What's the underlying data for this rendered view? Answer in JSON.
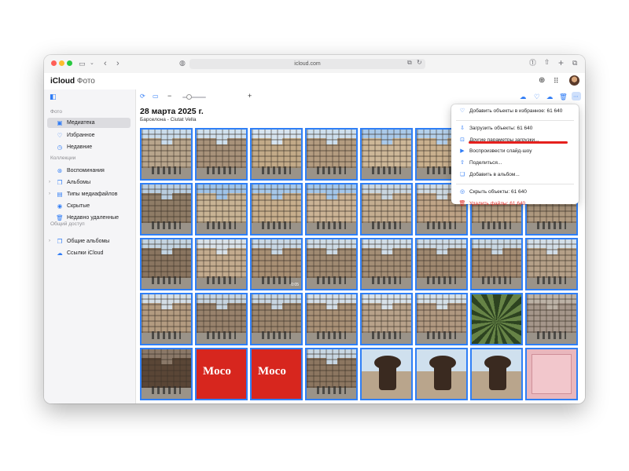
{
  "browser": {
    "url": "icloud.com",
    "traffic_lights": [
      "#ff5f57",
      "#febc2e",
      "#28c840"
    ]
  },
  "app": {
    "brand_bold": "iCloud",
    "brand_light": "Фото"
  },
  "sidebar": {
    "sections": [
      {
        "title": "Фото",
        "items": [
          {
            "label": "Медиатека",
            "icon": "photo-library-icon",
            "glyph": "▣",
            "active": true
          },
          {
            "label": "Избранное",
            "icon": "heart-icon",
            "glyph": "♡"
          },
          {
            "label": "Недавние",
            "icon": "clock-icon",
            "glyph": "◷"
          }
        ]
      },
      {
        "title": "Коллекции",
        "items": [
          {
            "label": "Воспоминания",
            "icon": "memories-icon",
            "glyph": "⊛"
          },
          {
            "label": "Альбомы",
            "icon": "albums-icon",
            "glyph": "❐",
            "chevron": true
          },
          {
            "label": "Типы медиафайлов",
            "icon": "media-types-icon",
            "glyph": "▤",
            "chevron": true
          },
          {
            "label": "Скрытые",
            "icon": "eye-hidden-icon",
            "glyph": "◉"
          },
          {
            "label": "Недавно удаленные",
            "icon": "trash-icon",
            "glyph": "🗑"
          }
        ]
      },
      {
        "title": "Общий доступ",
        "items": [
          {
            "label": "Общие альбомы",
            "icon": "shared-albums-icon",
            "glyph": "❐",
            "chevron": true
          },
          {
            "label": "Ссылки iCloud",
            "icon": "icloud-link-icon",
            "glyph": "☁"
          }
        ]
      }
    ]
  },
  "content": {
    "date_title": "28 марта 2025 г.",
    "location": "Барселона - Ciutat Vella",
    "zoom_minus": "−",
    "zoom_plus": "+",
    "zoom_level": 0.2
  },
  "thumbnails": [
    {
      "kind": "street",
      "sky": "#c9dcec",
      "bld": "#b8a58c"
    },
    {
      "kind": "street",
      "sky": "#cfe0ee",
      "bld": "#a8927a"
    },
    {
      "kind": "street",
      "sky": "#d6e4f0",
      "bld": "#c2aa88"
    },
    {
      "kind": "street",
      "sky": "#cddfee",
      "bld": "#b49c80"
    },
    {
      "kind": "street",
      "sky": "#a9c9ea",
      "bld": "#cdb798"
    },
    {
      "kind": "street",
      "sky": "#b3d0ec",
      "bld": "#c9b08e"
    },
    {
      "kind": "street",
      "sky": "#c6daea",
      "bld": "#b59d82"
    },
    {
      "kind": "street",
      "sky": "#d0e0ec",
      "bld": "#bba588"
    },
    {
      "kind": "street",
      "sky": "#b9cde0",
      "bld": "#8f7c66"
    },
    {
      "kind": "street",
      "sky": "#9fc3e8",
      "bld": "#c8b394"
    },
    {
      "kind": "street",
      "sky": "#a6c8ea",
      "bld": "#c7ae8c"
    },
    {
      "kind": "street",
      "sky": "#a3c6ea",
      "bld": "#cbb395"
    },
    {
      "kind": "street",
      "sky": "#c9d6e0",
      "bld": "#c4ad90"
    },
    {
      "kind": "street",
      "sky": "#cfdbe4",
      "bld": "#bfa487"
    },
    {
      "kind": "street",
      "sky": "#cadbe9",
      "bld": "#b8a084"
    },
    {
      "kind": "street",
      "sky": "#d2dde6",
      "bld": "#b09a80"
    },
    {
      "kind": "street",
      "sky": "#c3d4e2",
      "bld": "#8a7560"
    },
    {
      "kind": "street",
      "sky": "#d8e2ea",
      "bld": "#c3ab8e"
    },
    {
      "kind": "street",
      "sky": "#c8d8e6",
      "bld": "#a88f74",
      "duration": "0:05"
    },
    {
      "kind": "street",
      "sky": "#cddbe6",
      "bld": "#a08a72"
    },
    {
      "kind": "street",
      "sky": "#d0dde8",
      "bld": "#a48e76"
    },
    {
      "kind": "street",
      "sky": "#ccdae6",
      "bld": "#9f8870"
    },
    {
      "kind": "street",
      "sky": "#c9d8e4",
      "bld": "#a38b72"
    },
    {
      "kind": "street",
      "sky": "#d2dee8",
      "bld": "#b5a088"
    },
    {
      "kind": "street",
      "sky": "#d4dee6",
      "bld": "#b39b80"
    },
    {
      "kind": "street",
      "sky": "#c6d4e0",
      "bld": "#98826c"
    },
    {
      "kind": "street",
      "sky": "#c8d6e2",
      "bld": "#9c866e"
    },
    {
      "kind": "street",
      "sky": "#d3dee8",
      "bld": "#a89076"
    },
    {
      "kind": "street",
      "sky": "#d8e2ea",
      "bld": "#b8a28a"
    },
    {
      "kind": "street",
      "sky": "#d5e0e8",
      "bld": "#b09880"
    },
    {
      "kind": "palm"
    },
    {
      "kind": "street",
      "sky": "#bcb2a6",
      "bld": "#a5968a"
    },
    {
      "kind": "street",
      "sky": "#8a7868",
      "bld": "#5a4636"
    },
    {
      "kind": "moco",
      "text": "Moco"
    },
    {
      "kind": "moco",
      "text": "Moco"
    },
    {
      "kind": "street",
      "sky": "#c7d6e2",
      "bld": "#8c7660"
    },
    {
      "kind": "statue"
    },
    {
      "kind": "statue"
    },
    {
      "kind": "statue"
    },
    {
      "kind": "pink"
    }
  ],
  "menu": {
    "items": [
      {
        "label": "Добавить объекты в избранное: 61 640",
        "icon": "heart-icon",
        "glyph": "♡"
      },
      {
        "sep": true
      },
      {
        "label": "Загрузить объекты: 61 640",
        "icon": "cloud-download-icon",
        "glyph": "⇩"
      },
      {
        "label": "Другие параметры загрузки...",
        "icon": "download-options-icon",
        "glyph": "⊡",
        "underline": true
      },
      {
        "label": "Воспроизвести слайд-шоу",
        "icon": "slideshow-icon",
        "glyph": "▶"
      },
      {
        "label": "Поделиться...",
        "icon": "share-icon",
        "glyph": "⇧"
      },
      {
        "label": "Добавить в альбом...",
        "icon": "add-album-icon",
        "glyph": "❏"
      },
      {
        "sep": true
      },
      {
        "label": "Скрыть объекты: 61 640",
        "icon": "eye-hidden-icon",
        "glyph": "◎"
      },
      {
        "label": "Удалить файлы: 61 640",
        "icon": "trash-icon",
        "glyph": "🗑",
        "danger": true
      }
    ]
  },
  "colors": {
    "accent": "#2f7cf6",
    "selection_border": "#2f7ff6",
    "danger": "#e0302a",
    "underline": "#e5201d"
  }
}
